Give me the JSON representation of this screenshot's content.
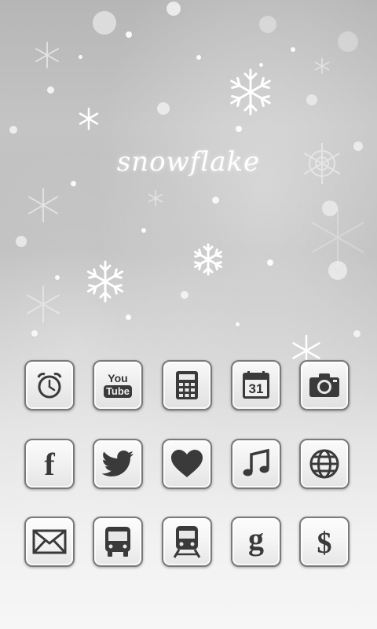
{
  "title": "snowflake",
  "icons": [
    {
      "name": "alarm-clock-icon"
    },
    {
      "name": "youtube-icon",
      "line1": "You",
      "line2": "Tube"
    },
    {
      "name": "calculator-icon"
    },
    {
      "name": "calendar-icon",
      "day": "31"
    },
    {
      "name": "camera-icon"
    },
    {
      "name": "facebook-icon",
      "glyph": "f"
    },
    {
      "name": "twitter-bird-icon"
    },
    {
      "name": "heart-icon"
    },
    {
      "name": "music-note-icon"
    },
    {
      "name": "globe-icon"
    },
    {
      "name": "mail-envelope-icon"
    },
    {
      "name": "bus-icon"
    },
    {
      "name": "train-icon"
    },
    {
      "name": "google-icon",
      "glyph": "g"
    },
    {
      "name": "dollar-icon",
      "glyph": "$"
    }
  ],
  "colors": {
    "icon_glyph": "#3a3a3a",
    "icon_border": "#7a7a7a",
    "title": "#ffffff"
  }
}
